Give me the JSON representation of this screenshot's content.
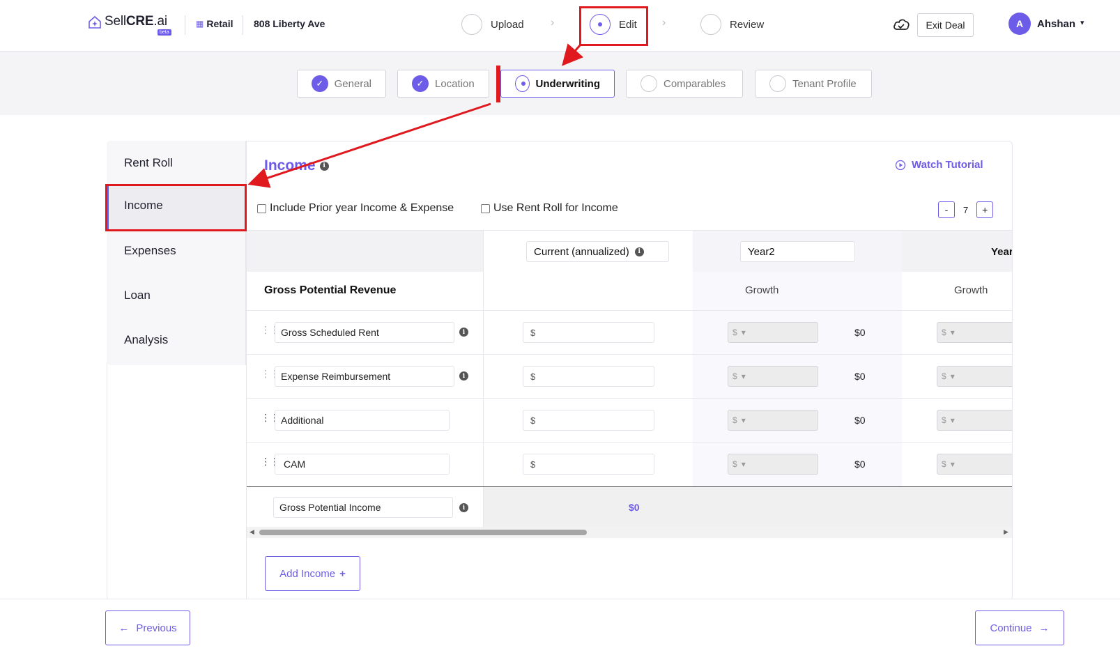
{
  "brand": {
    "name_plain": "Sell",
    "name_bold": "CRE",
    "name_suffix": ".ai",
    "badge": "beta"
  },
  "header": {
    "property_type": "Retail",
    "address": "808 Liberty Ave",
    "steps": [
      {
        "label": "Upload"
      },
      {
        "label": "Edit"
      },
      {
        "label": "Review"
      }
    ],
    "exit_label": "Exit Deal",
    "user_initial": "A",
    "user_name": "Ahshan"
  },
  "subtabs": [
    {
      "label": "General",
      "state": "done"
    },
    {
      "label": "Location",
      "state": "done"
    },
    {
      "label": "Underwriting",
      "state": "active"
    },
    {
      "label": "Comparables",
      "state": "todo"
    },
    {
      "label": "Tenant Profile",
      "state": "todo"
    }
  ],
  "sidebar": {
    "items": [
      {
        "label": "Rent Roll"
      },
      {
        "label": "Income"
      },
      {
        "label": "Expenses"
      },
      {
        "label": "Loan"
      },
      {
        "label": "Analysis"
      }
    ]
  },
  "main": {
    "title": "Income",
    "watch_tutorial": "Watch Tutorial",
    "checkbox_prior": "Include Prior year Income & Expense",
    "checkbox_rentroll": "Use Rent Roll for Income",
    "year_minus": "-",
    "year_count": "7",
    "year_plus": "+",
    "columns": {
      "current": "Current (annualized)",
      "year2": "Year2",
      "year3": "Year"
    },
    "section_title": "Gross Potential Revenue",
    "growth_label": "Growth",
    "rows": [
      {
        "label": "Gross Scheduled Rent",
        "currency": "$",
        "growth_symbol": "$",
        "value": "$0"
      },
      {
        "label": "Expense Reimbursement",
        "currency": "$",
        "growth_symbol": "$",
        "value": "$0"
      },
      {
        "label": "Additional",
        "currency": "$",
        "growth_symbol": "$",
        "value": "$0"
      },
      {
        "label": "CAM",
        "currency": "$",
        "growth_symbol": "$",
        "value": "$0"
      }
    ],
    "total_label": "Gross Potential Income",
    "total_value": "$0",
    "add_income": "Add Income"
  },
  "footer": {
    "previous": "Previous",
    "continue": "Continue"
  },
  "colors": {
    "accent": "#6c5ce7",
    "annotation_red": "#e0191e"
  }
}
